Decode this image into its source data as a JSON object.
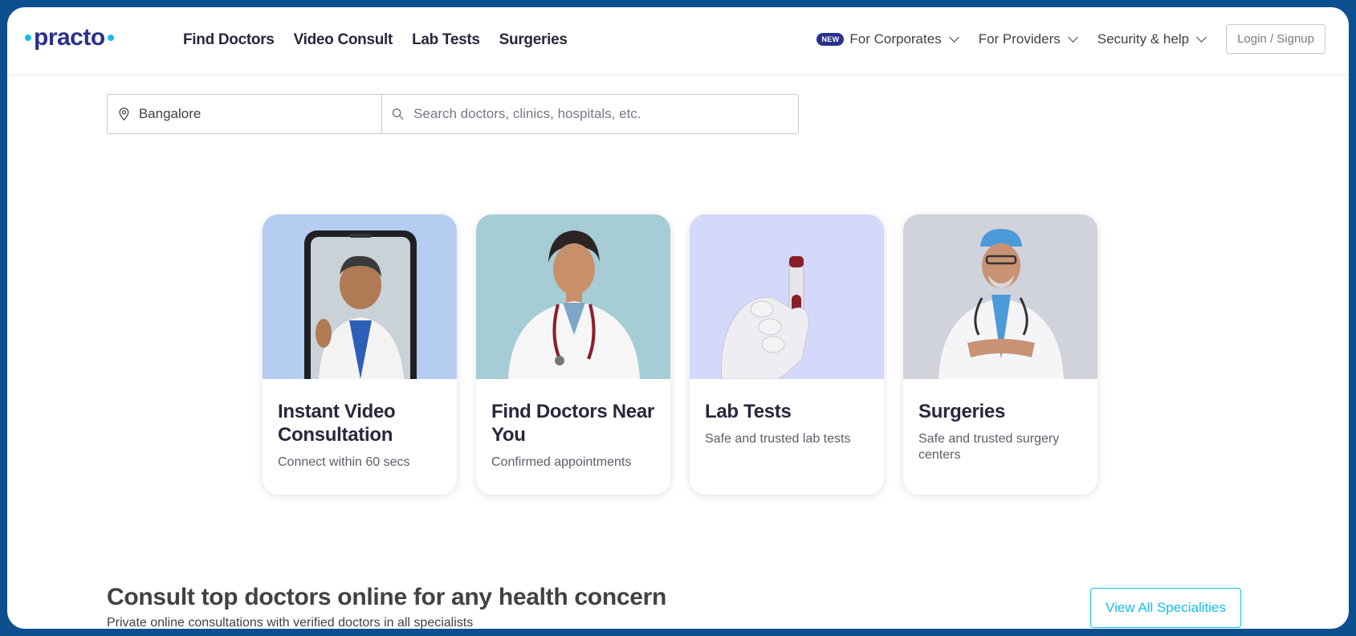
{
  "brand": {
    "name": "practo",
    "accent": "#14bef0",
    "primary": "#28328c"
  },
  "nav": {
    "main": [
      "Find Doctors",
      "Video Consult",
      "Lab Tests",
      "Surgeries"
    ],
    "badge": "NEW",
    "corporates": "For Corporates",
    "providers": "For Providers",
    "security": "Security & help",
    "login": "Login / Signup"
  },
  "search": {
    "location_value": "Bangalore",
    "query_placeholder": "Search doctors, clinics, hospitals, etc.",
    "location_icon": "location-pin-icon",
    "search_icon": "search-icon"
  },
  "cards": [
    {
      "title": "Instant Video Consultation",
      "subtitle": "Connect within 60 secs",
      "bg": "#b4cdf0"
    },
    {
      "title": "Find Doctors Near You",
      "subtitle": "Confirmed appointments",
      "bg": "#a6ccd6"
    },
    {
      "title": "Lab Tests",
      "subtitle": "Safe and trusted lab tests",
      "bg": "#d4d8fb"
    },
    {
      "title": "Surgeries",
      "subtitle": "Safe and trusted surgery centers",
      "bg": "#d0d2dc"
    }
  ],
  "consult": {
    "title": "Consult top doctors online for any health concern",
    "subtitle": "Private online consultations with verified doctors in all specialists",
    "view_all": "View All Specialities"
  }
}
